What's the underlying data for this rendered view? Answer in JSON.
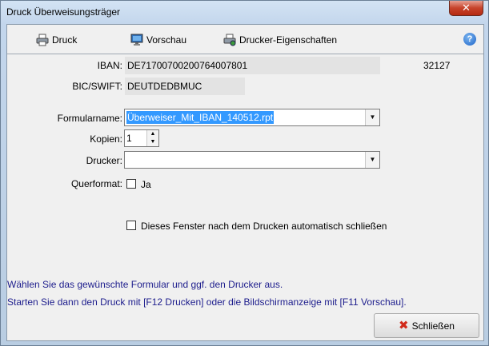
{
  "window": {
    "title": "Druck Überweisungsträger",
    "close_glyph": "✕"
  },
  "toolbar": {
    "print": {
      "label": "Druck",
      "icon": "printer-icon"
    },
    "preview": {
      "label": "Vorschau",
      "icon": "monitor-icon"
    },
    "printer_props": {
      "label": "Drucker-Eigenschaften",
      "icon": "printer-settings-icon"
    },
    "help": {
      "label": "?",
      "icon": "help-icon"
    }
  },
  "account": {
    "iban_label": "IBAN:",
    "iban_value": "DE71700700200764007801",
    "bic_label": "BIC/SWIFT:",
    "bic_value": "DEUTDEDBMUC",
    "number": "32127"
  },
  "form": {
    "template_label": "Formularname:",
    "template_value": "Überweiser_Mit_IBAN_140512.rpt",
    "copies_label": "Kopien:",
    "copies_value": "1",
    "printer_label": "Drucker:",
    "printer_value": "",
    "landscape_label": "Querformat:",
    "landscape_option": "Ja",
    "landscape_checked": false,
    "autoclose_label": "Dieses Fenster nach dem Drucken automatisch schließen",
    "autoclose_checked": false
  },
  "info": {
    "line1": "Wählen Sie das gewünschte Formular und ggf. den Drucker aus.",
    "line2": "Starten Sie dann den Druck mit [F12 Drucken] oder die Bildschirmanzeige mit [F11 Vorschau]."
  },
  "footer": {
    "close_label": "Schließen",
    "close_icon": "x-icon"
  }
}
